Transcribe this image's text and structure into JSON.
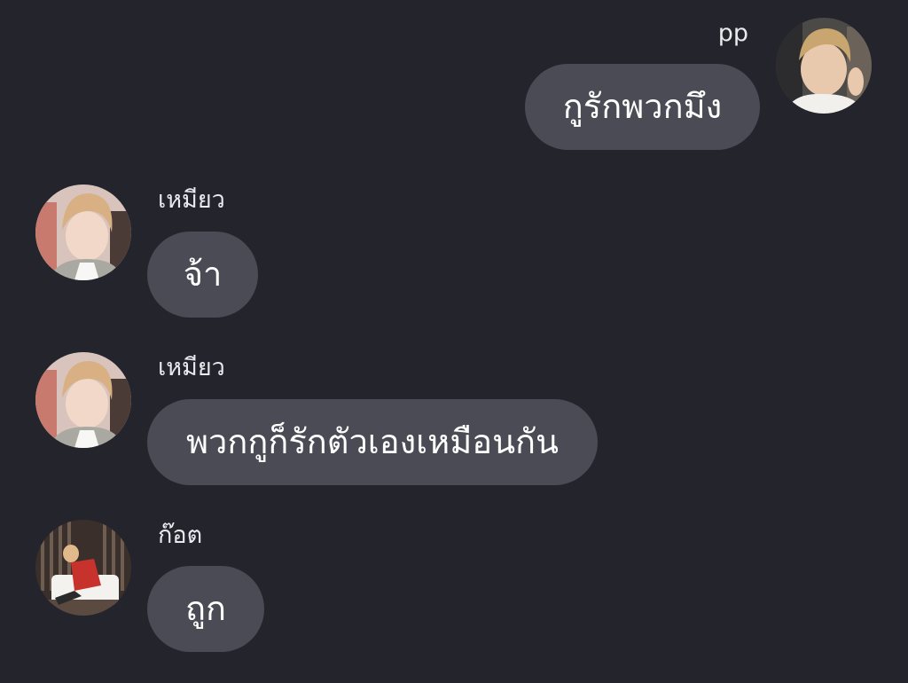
{
  "messages": [
    {
      "sender": "pp",
      "text": "กูรักพวกมึง",
      "side": "right"
    },
    {
      "sender": "เหมียว",
      "text": "จ้า",
      "side": "left"
    },
    {
      "sender": "เหมียว",
      "text": "พวกกูก็รักตัวเองเหมือนกัน",
      "side": "left"
    },
    {
      "sender": "ก๊อต",
      "text": "ถูก",
      "side": "left"
    }
  ],
  "colors": {
    "background": "#24252c",
    "bubble": "#4a4b54",
    "text": "#ffffff"
  }
}
